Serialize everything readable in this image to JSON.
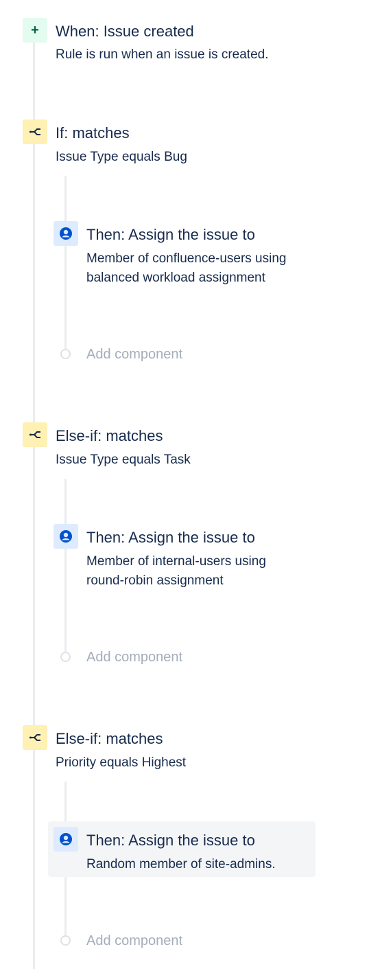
{
  "trigger": {
    "icon": "plus-icon",
    "title": "When: Issue created",
    "description": "Rule is run when an issue is created."
  },
  "blocks": [
    {
      "icon": "branch-icon",
      "title": "If: matches",
      "description": "Issue Type equals Bug",
      "action": {
        "icon": "user-icon",
        "title": "Then: Assign the issue to",
        "description_line1": "Member of confluence-users using",
        "description_line2": "balanced workload assignment"
      },
      "add_label": "Add component"
    },
    {
      "icon": "branch-icon",
      "title": "Else-if: matches",
      "description": "Issue Type equals Task",
      "action": {
        "icon": "user-icon",
        "title": "Then: Assign the issue to",
        "description_line1": "Member of internal-users using",
        "description_line2": "round-robin assignment"
      },
      "add_label": "Add component"
    },
    {
      "icon": "branch-icon",
      "title": "Else-if: matches",
      "description": "Priority equals Highest",
      "action": {
        "icon": "user-icon",
        "title": "Then: Assign the issue to",
        "description_line1": "Random member of site-admins.",
        "description_line2": ""
      },
      "add_label": "Add component"
    }
  ],
  "colors": {
    "trigger_bg": "#e3fcef",
    "condition_bg": "#fff0b3",
    "action_bg": "#deebff",
    "action_icon": "#0052cc",
    "timeline": "#ebecf0",
    "muted_text": "#a5adba",
    "selected_bg": "#f4f5f7"
  }
}
